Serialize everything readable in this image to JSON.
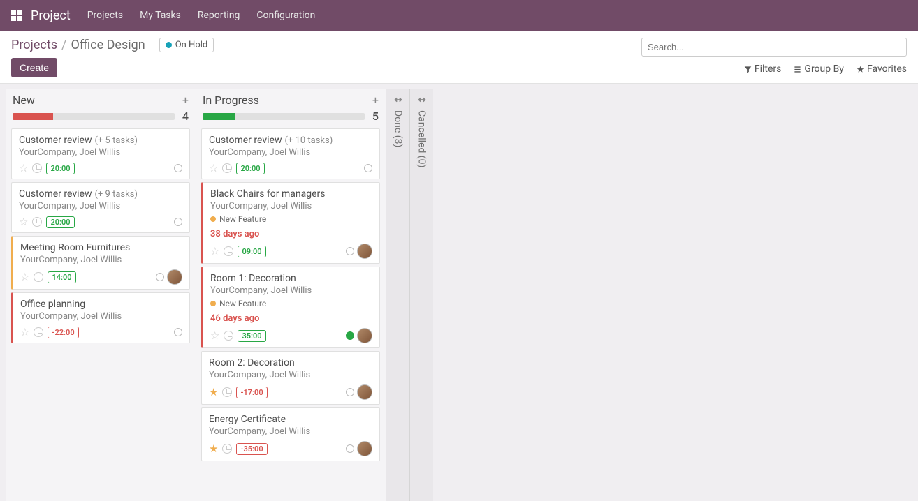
{
  "topbar": {
    "app_name": "Project",
    "menu": [
      "Projects",
      "My Tasks",
      "Reporting",
      "Configuration"
    ]
  },
  "breadcrumb": {
    "root": "Projects",
    "current": "Office Design"
  },
  "status": {
    "label": "On Hold",
    "color": "#17a2b8"
  },
  "buttons": {
    "create": "Create"
  },
  "search": {
    "placeholder": "Search..."
  },
  "filters": {
    "filters": "Filters",
    "groupby": "Group By",
    "favorites": "Favorites"
  },
  "columns": [
    {
      "title": "New",
      "count": "4",
      "progress": [
        {
          "color": "#d9534f",
          "pct": 25
        }
      ],
      "cards": [
        {
          "title": "Customer review",
          "sub": "(+ 5 tasks)",
          "company": "YourCompany, Joel Willis",
          "time": "20:00",
          "time_neg": false,
          "star": false,
          "kstate": "blank",
          "avatar": false
        },
        {
          "title": "Customer review",
          "sub": "(+ 9 tasks)",
          "company": "YourCompany, Joel Willis",
          "time": "20:00",
          "time_neg": false,
          "star": false,
          "kstate": "blank",
          "avatar": false
        },
        {
          "title": "Meeting Room Furnitures",
          "company": "YourCompany, Joel Willis",
          "time": "14:00",
          "time_neg": false,
          "star": false,
          "kstate": "blank",
          "avatar": true,
          "stripe": "yellow"
        },
        {
          "title": "Office planning",
          "company": "YourCompany, Joel Willis",
          "time": "-22:00",
          "time_neg": true,
          "star": false,
          "kstate": "blank",
          "avatar": false,
          "stripe": "red"
        }
      ]
    },
    {
      "title": "In Progress",
      "count": "5",
      "progress": [
        {
          "color": "#28a745",
          "pct": 20
        }
      ],
      "cards": [
        {
          "title": "Customer review",
          "sub": "(+ 10 tasks)",
          "company": "YourCompany, Joel Willis",
          "time": "20:00",
          "time_neg": false,
          "star": false,
          "kstate": "blank",
          "avatar": false
        },
        {
          "title": "Black Chairs for managers",
          "company": "YourCompany, Joel Willis",
          "tag": "New Feature",
          "overdue": "38 days ago",
          "time": "09:00",
          "time_neg": false,
          "star": false,
          "kstate": "blank",
          "avatar": true,
          "stripe": "red"
        },
        {
          "title": "Room 1: Decoration",
          "company": "YourCompany, Joel Willis",
          "tag": "New Feature",
          "overdue": "46 days ago",
          "time": "35:00",
          "time_neg": false,
          "star": false,
          "kstate": "green",
          "avatar": true,
          "stripe": "red"
        },
        {
          "title": "Room 2: Decoration",
          "company": "YourCompany, Joel Willis",
          "time": "-17:00",
          "time_neg": true,
          "star": true,
          "kstate": "blank",
          "avatar": true
        },
        {
          "title": "Energy Certificate",
          "company": "YourCompany, Joel Willis",
          "time": "-35:00",
          "time_neg": true,
          "star": true,
          "kstate": "blank",
          "avatar": true
        }
      ]
    }
  ],
  "folded": [
    {
      "label": "Done (3)"
    },
    {
      "label": "Cancelled (0)"
    }
  ]
}
